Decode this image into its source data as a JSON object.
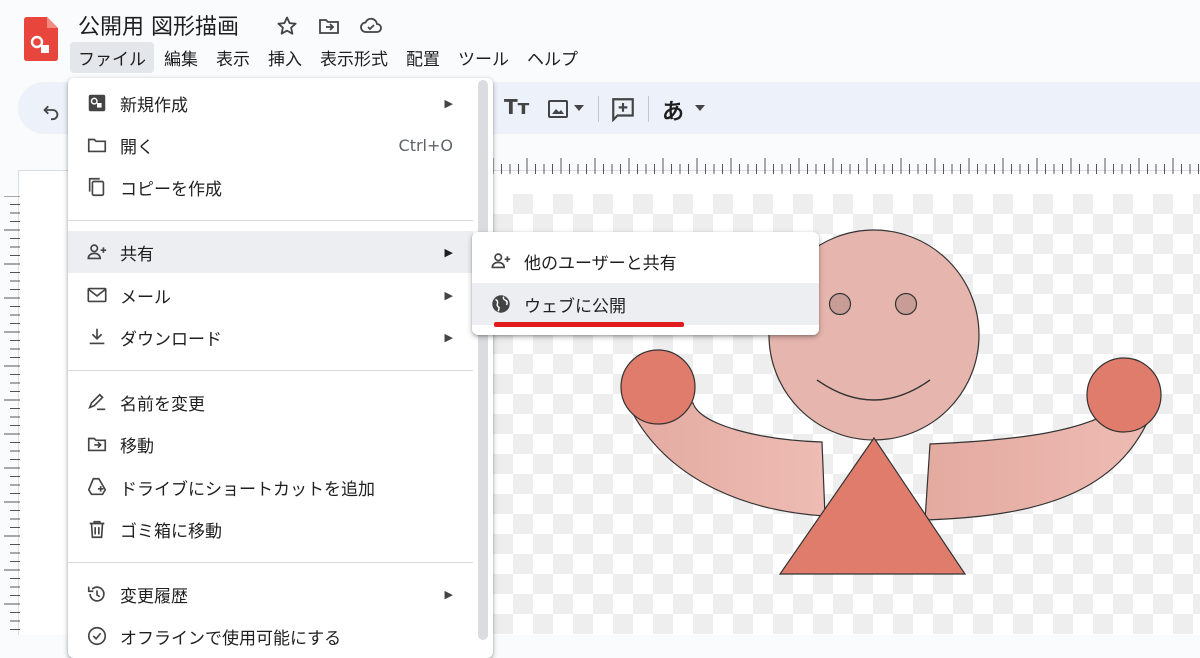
{
  "document": {
    "title": "公開用 図形描画"
  },
  "menubar": [
    "ファイル",
    "編集",
    "表示",
    "挿入",
    "表示形式",
    "配置",
    "ツール",
    "ヘルプ"
  ],
  "toolbar": {
    "text_style_label": "Tт",
    "input_tool_label": "あ"
  },
  "file_menu": {
    "items": [
      {
        "label": "新規作成",
        "icon": "new-icon",
        "submenu": true
      },
      {
        "label": "開く",
        "icon": "folder-icon",
        "shortcut": "Ctrl+O"
      },
      {
        "label": "コピーを作成",
        "icon": "copy-icon"
      },
      {
        "label": "共有",
        "icon": "person-add-icon",
        "submenu": true,
        "highlighted": true
      },
      {
        "label": "メール",
        "icon": "mail-icon",
        "submenu": true
      },
      {
        "label": "ダウンロード",
        "icon": "download-icon",
        "submenu": true
      },
      {
        "label": "名前を変更",
        "icon": "rename-icon"
      },
      {
        "label": "移動",
        "icon": "move-folder-icon"
      },
      {
        "label": "ドライブにショートカットを追加",
        "icon": "drive-shortcut-icon"
      },
      {
        "label": "ゴミ箱に移動",
        "icon": "trash-icon"
      },
      {
        "label": "変更履歴",
        "icon": "history-icon",
        "submenu": true
      },
      {
        "label": "オフラインで使用可能にする",
        "icon": "offline-icon"
      }
    ]
  },
  "share_submenu": {
    "items": [
      {
        "label": "他のユーザーと共有",
        "icon": "person-add-icon"
      },
      {
        "label": "ウェブに公開",
        "icon": "globe-icon",
        "highlighted": true
      }
    ]
  },
  "colors": {
    "accent_red": "#e01b1b",
    "head_fill": "#e6b5ad",
    "hand_fill": "#e07c6b",
    "body_fill": "#e07c6b",
    "menu_highlight": "#eceef1"
  }
}
